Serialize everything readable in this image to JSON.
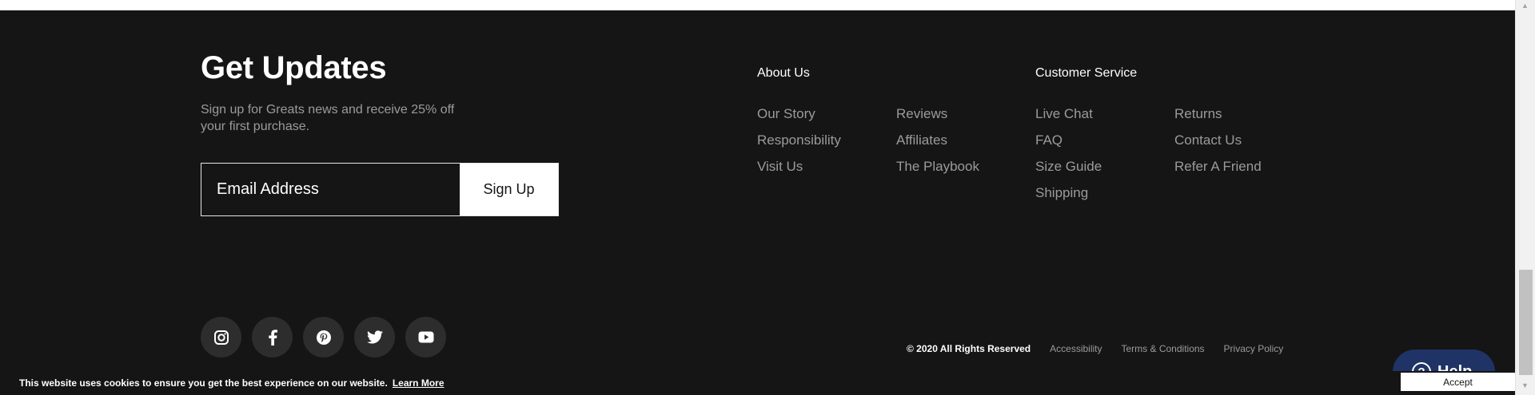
{
  "newsletter": {
    "title": "Get Updates",
    "description": "Sign up for Greats news and receive 25% off your first purchase.",
    "email_placeholder": "Email Address",
    "button_label": "Sign Up"
  },
  "about": {
    "heading": "About Us",
    "col1": [
      "Our Story",
      "Responsibility",
      "Visit Us"
    ],
    "col2": [
      "Reviews",
      "Affiliates",
      "The Playbook"
    ]
  },
  "service": {
    "heading": "Customer Service",
    "col1": [
      "Live Chat",
      "FAQ",
      "Size Guide",
      "Shipping"
    ],
    "col2": [
      "Returns",
      "Contact Us",
      "Refer A Friend"
    ]
  },
  "social": [
    "instagram-icon",
    "facebook-icon",
    "pinterest-icon",
    "twitter-icon",
    "youtube-icon"
  ],
  "legal": {
    "copyright": "© 2020 All Rights Reserved",
    "links": [
      "Accessibility",
      "Terms & Conditions",
      "Privacy Policy"
    ]
  },
  "help": {
    "label": "Help"
  },
  "cookie": {
    "text": "This website uses cookies to ensure you get the best experience on our website.",
    "link": "Learn More",
    "accept": "Accept"
  },
  "colors": {
    "background": "#151515",
    "muted_text": "#9b9b9b",
    "help_button": "#1f3366"
  }
}
